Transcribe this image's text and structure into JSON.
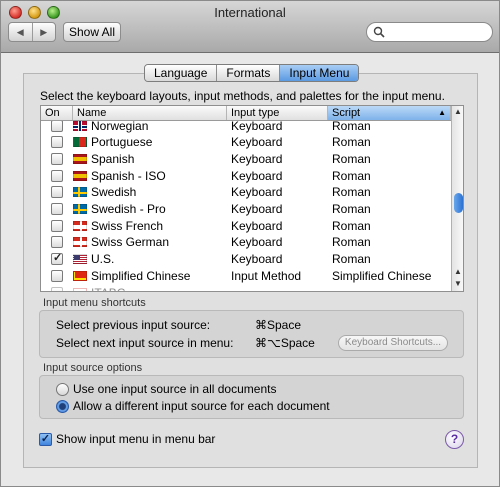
{
  "window": {
    "title": "International"
  },
  "toolbar": {
    "back_icon": "◀",
    "forward_icon": "▶",
    "show_all": "Show All",
    "search_placeholder": ""
  },
  "tabs": [
    {
      "label": "Language",
      "active": false
    },
    {
      "label": "Formats",
      "active": false
    },
    {
      "label": "Input Menu",
      "active": true
    }
  ],
  "instructions": "Select the keyboard layouts, input methods, and palettes for the input menu.",
  "table": {
    "headers": {
      "on": "On",
      "name": "Name",
      "type": "Input type",
      "script": "Script"
    },
    "rows": [
      {
        "checked": false,
        "name": "Norwegian",
        "type": "Keyboard",
        "script": "Roman",
        "flag": "norway"
      },
      {
        "checked": false,
        "name": "Portuguese",
        "type": "Keyboard",
        "script": "Roman",
        "flag": "portugal"
      },
      {
        "checked": false,
        "name": "Spanish",
        "type": "Keyboard",
        "script": "Roman",
        "flag": "spain"
      },
      {
        "checked": false,
        "name": "Spanish - ISO",
        "type": "Keyboard",
        "script": "Roman",
        "flag": "spain-iso"
      },
      {
        "checked": false,
        "name": "Swedish",
        "type": "Keyboard",
        "script": "Roman",
        "flag": "sweden"
      },
      {
        "checked": false,
        "name": "Swedish - Pro",
        "type": "Keyboard",
        "script": "Roman",
        "flag": "sweden-pro"
      },
      {
        "checked": false,
        "name": "Swiss French",
        "type": "Keyboard",
        "script": "Roman",
        "flag": "switzerland"
      },
      {
        "checked": false,
        "name": "Swiss German",
        "type": "Keyboard",
        "script": "Roman",
        "flag": "switzerland"
      },
      {
        "checked": true,
        "name": "U.S.",
        "type": "Keyboard",
        "script": "Roman",
        "flag": "usa"
      },
      {
        "checked": false,
        "name": "Simplified Chinese",
        "type": "Input Method",
        "script": "Simplified Chinese",
        "flag": "china"
      },
      {
        "checked": false,
        "name": "ITABC",
        "type": "",
        "script": "",
        "flag": "itabc"
      }
    ]
  },
  "shortcuts": {
    "title": "Input menu shortcuts",
    "previous_label": "Select previous input source:",
    "previous_key": "⌘Space",
    "next_label": "Select next input source in menu:",
    "next_key": "⌘⌥Space",
    "button": "Keyboard Shortcuts..."
  },
  "options": {
    "title": "Input source options",
    "opt1": "Use one input source in all documents",
    "opt2": "Allow a different input source for each document",
    "selected": "opt2"
  },
  "show_in_menubar": {
    "label": "Show input menu in menu bar",
    "checked": true
  },
  "help": "?"
}
